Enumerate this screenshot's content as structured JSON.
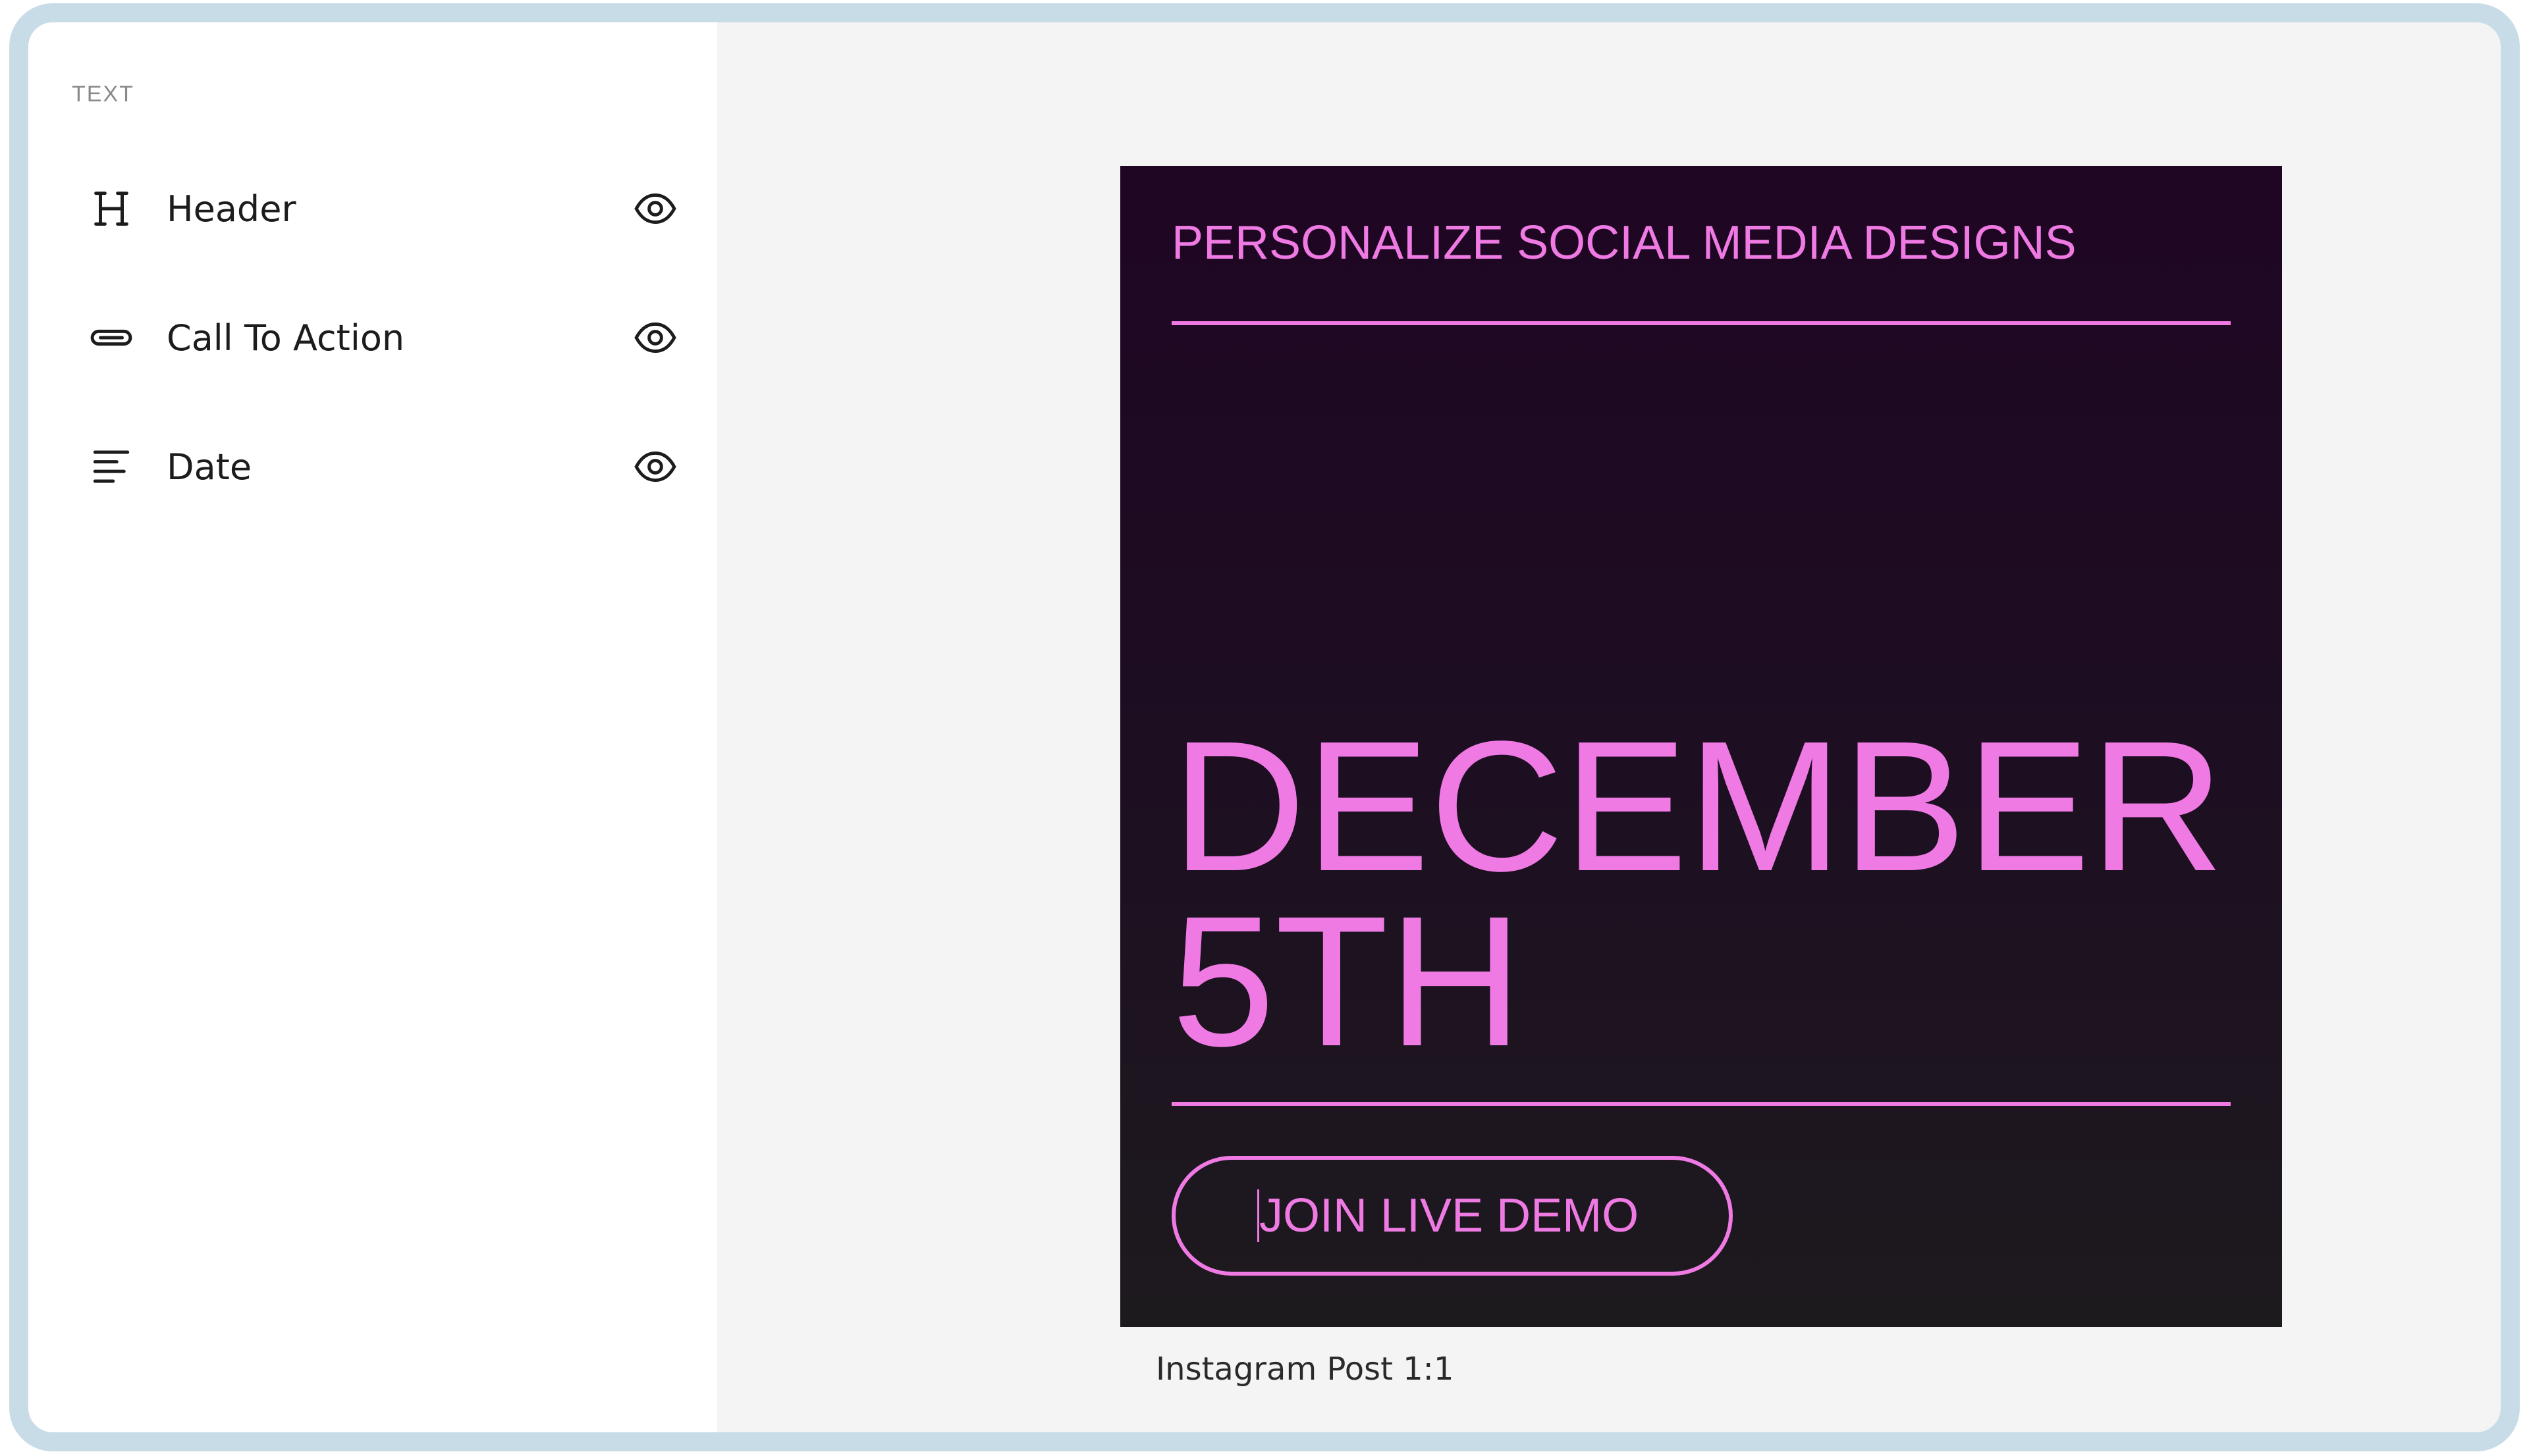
{
  "sidebar": {
    "section_label": "TEXT",
    "items": [
      {
        "label": "Header",
        "icon": "heading-icon",
        "visible": true
      },
      {
        "label": "Call To Action",
        "icon": "link-icon",
        "visible": true
      },
      {
        "label": "Date",
        "icon": "paragraph-icon",
        "visible": true
      }
    ]
  },
  "post": {
    "header": "PERSONALIZE SOCIAL MEDIA DESIGNS",
    "date": "DECEMBER\n5TH",
    "cta": "JOIN LIVE DEMO",
    "caption": "Instagram Post 1:1",
    "colors": {
      "accent": "#f07ae4",
      "background_top": "#1f0623",
      "background_bottom": "#1d1a1e"
    }
  },
  "colors": {
    "frame_border": "#c8dce8",
    "canvas_background": "#f4f4f4",
    "sidebar_background": "#ffffff"
  }
}
